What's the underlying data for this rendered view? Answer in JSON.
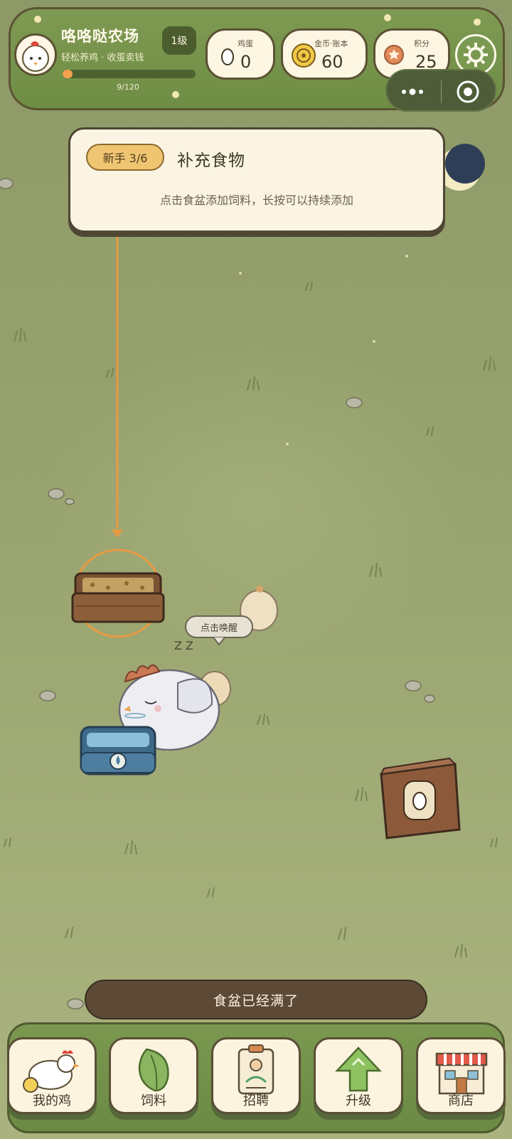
{
  "header": {
    "farm_name": "咯咯哒农场",
    "subtitle": "轻松养鸡 · 收蛋卖钱",
    "level": "1级",
    "xp_text": "9/120",
    "xp_progress": 0.075
  },
  "stats": {
    "eggs": {
      "label": "鸡蛋",
      "value": "0",
      "icon": "egg-icon"
    },
    "coins": {
      "label": "金币·账本",
      "value": "60",
      "icon": "coin-icon"
    },
    "points": {
      "label": "积分",
      "value": "25",
      "icon": "star-badge-icon"
    }
  },
  "tutorial": {
    "badge": "新手 3/6",
    "title": "补充食物",
    "description": "点击食盆添加饲料，长按可以持续添加"
  },
  "scene": {
    "wake_bubble": "点击唤醒",
    "sleep_text": "Z Z"
  },
  "toast": "食盆已经满了",
  "nav": [
    {
      "label": "我的鸡",
      "icon": "hen-icon"
    },
    {
      "label": "饲料",
      "icon": "leaf-icon"
    },
    {
      "label": "招聘",
      "icon": "id-badge-icon"
    },
    {
      "label": "升级",
      "icon": "up-arrow-icon"
    },
    {
      "label": "商店",
      "icon": "shop-icon"
    }
  ],
  "colors": {
    "grass": "#97a26e",
    "header_green": "#7f9a52",
    "cream": "#fdf6e3",
    "outline": "#5b5233",
    "accent_orange": "#f0a24c"
  }
}
